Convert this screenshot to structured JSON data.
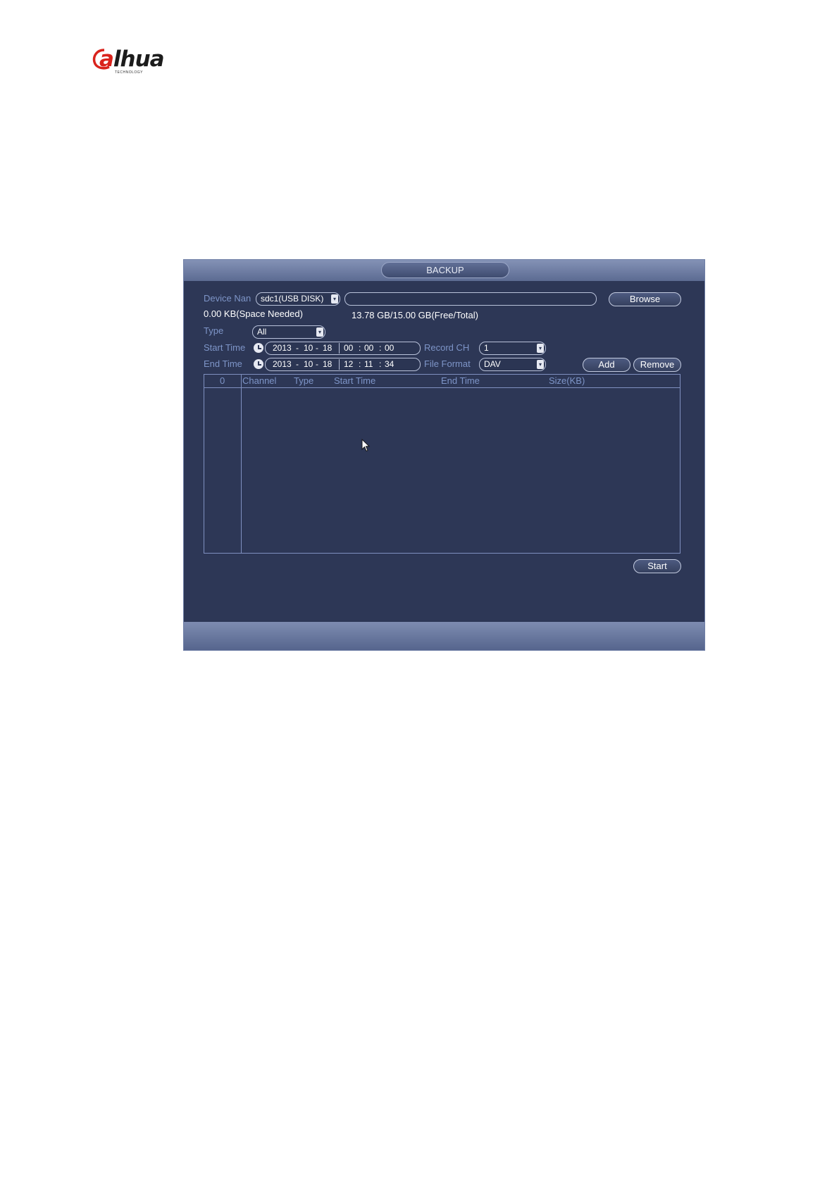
{
  "logo": {
    "brand": "alhua",
    "sub": "TECHNOLOGY"
  },
  "window": {
    "title": "BACKUP",
    "device_name_label": "Device Nan",
    "device_name_value": "sdc1(USB DISK)",
    "path_value": "",
    "browse_label": "Browse",
    "space_needed": "0.00 KB(Space Needed)",
    "free_total": "13.78 GB/15.00 GB(Free/Total)",
    "type_label": "Type",
    "type_value": "All",
    "start_time_label": "Start Time",
    "start_date": {
      "y": "2013",
      "m": "10",
      "d": "18"
    },
    "start_clock": {
      "h": "00",
      "mi": "00",
      "s": "00"
    },
    "end_time_label": "End Time",
    "end_date": {
      "y": "2013",
      "m": "10",
      "d": "18"
    },
    "end_clock": {
      "h": "12",
      "mi": "11",
      "s": "34"
    },
    "record_ch_label": "Record CH",
    "record_ch_value": "1",
    "file_format_label": "File Format",
    "file_format_value": "DAV",
    "add_label": "Add",
    "remove_label": "Remove",
    "table": {
      "count": "0",
      "headers": [
        "Channel",
        "Type",
        "Start Time",
        "End Time",
        "Size(KB)"
      ]
    },
    "start_label": "Start"
  },
  "colors": {
    "window_bg": "#2d3756",
    "label": "#7e95c8",
    "logo_red": "#d9231c"
  },
  "icons": [
    "clock-icon",
    "dropdown-arrow-icon",
    "mouse-pointer-icon"
  ]
}
